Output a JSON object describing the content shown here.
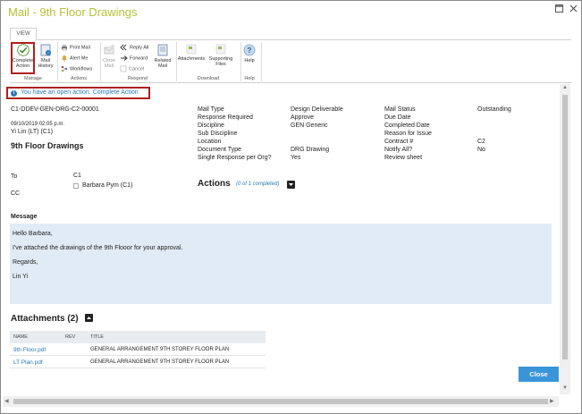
{
  "window": {
    "title": "Mail - 9th Floor Drawings"
  },
  "ribbon": {
    "tab": "VIEW",
    "buttons": {
      "complete_action": "Complete Action",
      "mail_history": "Mail History",
      "print_mail": "Print Mail",
      "alert_me": "Alert Me",
      "workflows": "Workflows",
      "close_mail": "Close Mail",
      "reply_all": "Reply All",
      "forward": "Forward",
      "cancel": "Cancel",
      "related_mail": "Related Mail",
      "attachments": "Attachments",
      "supporting_files": "Supporting Files",
      "help": "Help"
    },
    "groups": {
      "manage": "Manage",
      "actions": "Actions",
      "respond": "Respond",
      "download": "Download",
      "help": "Help"
    }
  },
  "banner": {
    "text": "You have an open action. Complete Action"
  },
  "mail": {
    "number": "C1-DDEV-GEN-DRG-C2-00001",
    "datetime": "09/10/2019 02:05 p.m.",
    "sender": "Yi Lin (LT) (C1)",
    "subject": "9th Floor Drawings"
  },
  "fields": {
    "col1": [
      "Mail Type",
      "Response Required",
      "Discipline",
      "Sub Discipline",
      "Location",
      "Document Type",
      "Single Response per Org?"
    ],
    "col2": [
      "Design Deliverable",
      "Approve",
      "GEN Generic",
      "",
      "",
      "DRG Drawing",
      "Yes"
    ],
    "col3": [
      "Mail Status",
      "Due Date",
      "Completed Date",
      "Reason for Issue",
      "Contract #",
      "Notify All?",
      "Review sheet"
    ],
    "col4": [
      "Outstanding",
      "",
      "",
      "",
      "C2",
      "No",
      ""
    ]
  },
  "recipients": {
    "to_label": "To",
    "to_org": "C1",
    "to_person": "Barbara Pym (C1)",
    "cc_label": "CC"
  },
  "actions": {
    "heading": "Actions",
    "progress": "(0 of 1 completed)"
  },
  "message": {
    "label": "Message",
    "lines": [
      "Hello Barbara,",
      "I've attached the drawings of the 9th Flooor for your approval.",
      "Regards,",
      "Lin Yi"
    ]
  },
  "attachments": {
    "heading": "Attachments (2)",
    "columns": [
      "NAME",
      "REV",
      "TITLE"
    ],
    "rows": [
      {
        "name": "9th Floor.pdf",
        "rev": "",
        "title": "GENERAL ARRANGEMENT 9TH STOREY FLOOR PLAN"
      },
      {
        "name": "LT Plan.pdf",
        "rev": "",
        "title": "GENERAL ARRANGEMENT 9TH STOREY FLOOR PLAN"
      }
    ]
  },
  "footer": {
    "close": "Close"
  },
  "colors": {
    "accent": "#3a95d8",
    "title": "#b5c334",
    "highlight": "#b02020",
    "message_bg": "#e1ebf5"
  }
}
